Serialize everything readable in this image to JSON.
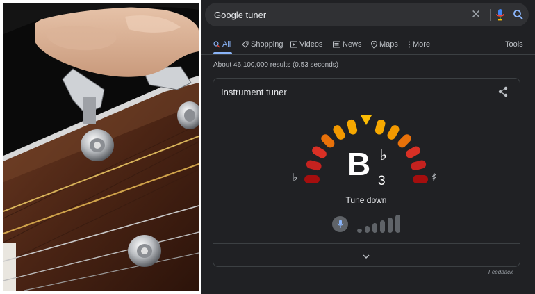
{
  "search": {
    "query": "Google tuner"
  },
  "tabs": [
    {
      "label": "All",
      "icon": "search-icon",
      "active": true
    },
    {
      "label": "Shopping",
      "icon": "tag-icon"
    },
    {
      "label": "Videos",
      "icon": "play-icon"
    },
    {
      "label": "News",
      "icon": "newspaper-icon"
    },
    {
      "label": "Maps",
      "icon": "map-pin-icon"
    },
    {
      "label": "More",
      "icon": "more-icon"
    }
  ],
  "tools_label": "Tools",
  "results_stats": "About 46,100,000 results (0.53 seconds)",
  "tuner": {
    "title": "Instrument tuner",
    "note": "B",
    "octave": "3",
    "note_accidental": "♭",
    "flat_symbol": "♭",
    "sharp_symbol": "♯",
    "status": "Tune down",
    "mic_level_bars": 6
  },
  "feedback_label": "Feedback",
  "colors": {
    "page_bg": "#202124",
    "accent_blue": "#8ab4f8",
    "indicator_yellow": "#fbbc04",
    "arc_orange": "#f29900",
    "arc_red": "#d93025",
    "arc_dark_red": "#a50e0e"
  }
}
